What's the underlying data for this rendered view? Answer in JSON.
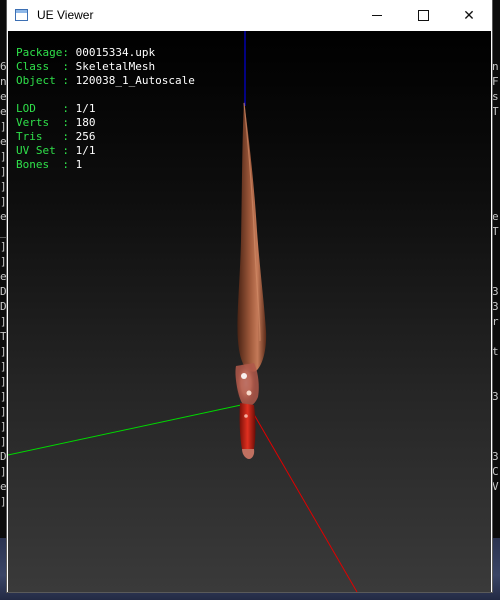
{
  "background_console": {
    "left_edge_chars": [
      "6",
      "n",
      "e",
      "e",
      "]",
      "e",
      "]",
      "]",
      "]",
      "]",
      "e",
      "_",
      "]",
      "]",
      "e",
      "D",
      "D",
      "]",
      "T",
      "]",
      "]",
      "]",
      "]",
      "]",
      "]",
      "]",
      "D",
      "]",
      "e",
      "]"
    ],
    "right_edge_chars": [
      "n",
      "F",
      "s",
      "T",
      "",
      "",
      "",
      "",
      "",
      "",
      "e",
      "T",
      "",
      "",
      "",
      "3",
      "3",
      "r",
      "",
      "t",
      "",
      "",
      "3",
      "",
      "",
      "",
      "3",
      "C",
      "V",
      ""
    ]
  },
  "window": {
    "title": "UE Viewer",
    "controls": {
      "minimize": "minimize",
      "maximize": "maximize",
      "close": "✕"
    }
  },
  "info": {
    "package": {
      "label": "Package: ",
      "value": "00015334.upk"
    },
    "class": {
      "label": "Class  : ",
      "value": "SkeletalMesh"
    },
    "object": {
      "label": "Object : ",
      "value": "120038_1_Autoscale"
    },
    "lod": {
      "label": "LOD    : ",
      "value": "1/1"
    },
    "verts": {
      "label": "Verts  : ",
      "value": "180"
    },
    "tris": {
      "label": "Tris   : ",
      "value": "256"
    },
    "uvset": {
      "label": "UV Set : ",
      "value": "1/1"
    },
    "bones": {
      "label": "Bones  : ",
      "value": "1"
    }
  },
  "colors": {
    "label_green": "#2fe04a",
    "value_white": "#ffffff",
    "axis_x": "#e00000",
    "axis_y": "#00d800",
    "axis_z": "#0000ff",
    "blade": "#8a4a32"
  }
}
